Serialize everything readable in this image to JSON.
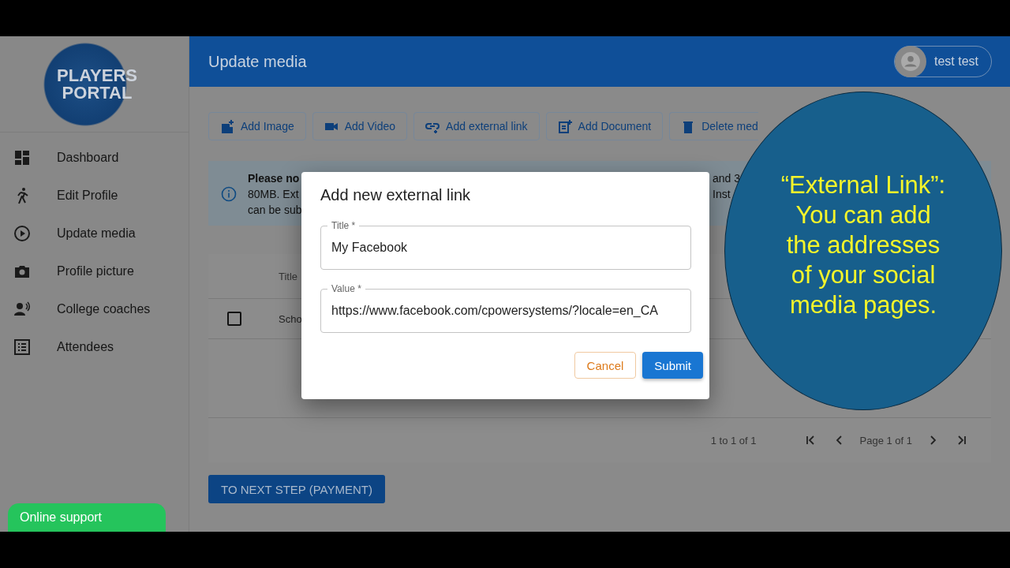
{
  "sidebar": {
    "logo": "PLAYERS PORTAL",
    "items": [
      {
        "label": "Dashboard"
      },
      {
        "label": "Edit Profile"
      },
      {
        "label": "Update media"
      },
      {
        "label": "Profile picture"
      },
      {
        "label": "College coaches"
      },
      {
        "label": "Attendees"
      }
    ]
  },
  "header": {
    "title": "Update media",
    "user": "test test"
  },
  "toolbar": [
    {
      "label": "Add Image"
    },
    {
      "label": "Add Video"
    },
    {
      "label": "Add external link"
    },
    {
      "label": "Add Document"
    },
    {
      "label": "Delete med"
    }
  ],
  "notice": {
    "left": [
      {
        "text": "Please no",
        "bold": true
      },
      {
        "text": "80MB. Ext",
        "bold": false
      },
      {
        "text": "can be sub",
        "bold": false
      }
    ],
    "right": [
      "and 3",
      "Inst"
    ]
  },
  "table": {
    "columns": [
      "Title"
    ],
    "rows": [
      {
        "checked": false,
        "cells": [
          "Scho"
        ]
      }
    ],
    "range": "1 to 1 of 1",
    "page": "Page 1 of 1"
  },
  "next_button": "TO NEXT STEP (PAYMENT)",
  "support_button": "Online support",
  "dialog": {
    "title": "Add new external link",
    "fields": [
      {
        "label": "Title *",
        "value": "My Facebook"
      },
      {
        "label": "Value *",
        "value": "https://www.facebook.com/cpowersystems/?locale=en_CA"
      }
    ],
    "buttons": [
      {
        "label": "Cancel",
        "kind": "outlined"
      },
      {
        "label": "Submit",
        "kind": "contained"
      }
    ]
  },
  "callout": {
    "text": "“External Link”:\nYou can add\nthe addresses\nof your social\nmedia pages."
  }
}
